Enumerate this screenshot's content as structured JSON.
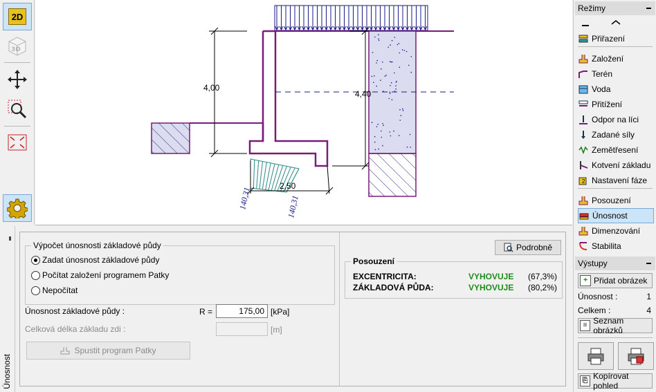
{
  "toolbar": {
    "btn_2d": "2D",
    "btn_3d": "3D"
  },
  "canvas": {
    "dim_height": "4,00",
    "dim_height2": "4,40",
    "dim_width": "2,50",
    "stress_left": "140,31",
    "stress_right": "140,31"
  },
  "rezimy": {
    "title": "Režimy",
    "items": [
      {
        "label": "Přiřazení",
        "icon": "assign-icon"
      },
      {
        "label": "Založení",
        "icon": "foundation-icon"
      },
      {
        "label": "Terén",
        "icon": "terrain-icon"
      },
      {
        "label": "Voda",
        "icon": "water-icon"
      },
      {
        "label": "Přitížení",
        "icon": "surcharge-icon"
      },
      {
        "label": "Odpor na líci",
        "icon": "front-resistance-icon"
      },
      {
        "label": "Zadané síly",
        "icon": "applied-forces-icon"
      },
      {
        "label": "Zemětřesení",
        "icon": "earthquake-icon"
      },
      {
        "label": "Kotvení základu",
        "icon": "anchoring-icon"
      },
      {
        "label": "Nastavení fáze",
        "icon": "stage-settings-icon"
      },
      {
        "label": "Posouzení",
        "icon": "verification-icon"
      },
      {
        "label": "Únosnost",
        "icon": "bearing-capacity-icon"
      },
      {
        "label": "Dimenzování",
        "icon": "dimensioning-icon"
      },
      {
        "label": "Stabilita",
        "icon": "stability-icon"
      }
    ],
    "selected": "Únosnost"
  },
  "vystupy": {
    "title": "Výstupy",
    "add_picture": "Přidat obrázek",
    "unosnost_label": "Únosnost :",
    "unosnost_value": "1",
    "celkem_label": "Celkem :",
    "celkem_value": "4",
    "list_pictures": "Seznam obrázků",
    "copy_view": "Kopírovat pohled"
  },
  "bottom": {
    "tab_label": "Únosnost",
    "group_title": "Výpočet únosnosti základové půdy",
    "radio1": "Zadat únosnost základové půdy",
    "radio2": "Počítat založení programem Patky",
    "radio3": "Nepočítat",
    "selected_radio": 1,
    "capacity_label": "Únosnost základové půdy :",
    "r_label": "R =",
    "r_value": "175,00",
    "r_unit": "[kPa]",
    "length_label": "Celková délka základu zdi :",
    "length_value": "",
    "length_unit": "[m]",
    "run_button": "Spustit program Patky",
    "details_button": "Podrobně",
    "posouzeni_title": "Posouzení",
    "row1_label": "EXCENTRICITA:",
    "row1_status": "VYHOVUJE",
    "row1_pct": "(67,3%)",
    "row2_label": "ZÁKLADOVÁ PŮDA:",
    "row2_status": "VYHOVUJE",
    "row2_pct": "(80,2%)"
  },
  "colors": {
    "wall": "#7a1a7a",
    "soil_fill": "#dcdcf0",
    "hatch": "#1a1a8a",
    "dim_blue": "#1a1a8a",
    "stress": "#2a8a8a",
    "ok_green": "#1e8c1e",
    "selection": "#cce4f7"
  }
}
